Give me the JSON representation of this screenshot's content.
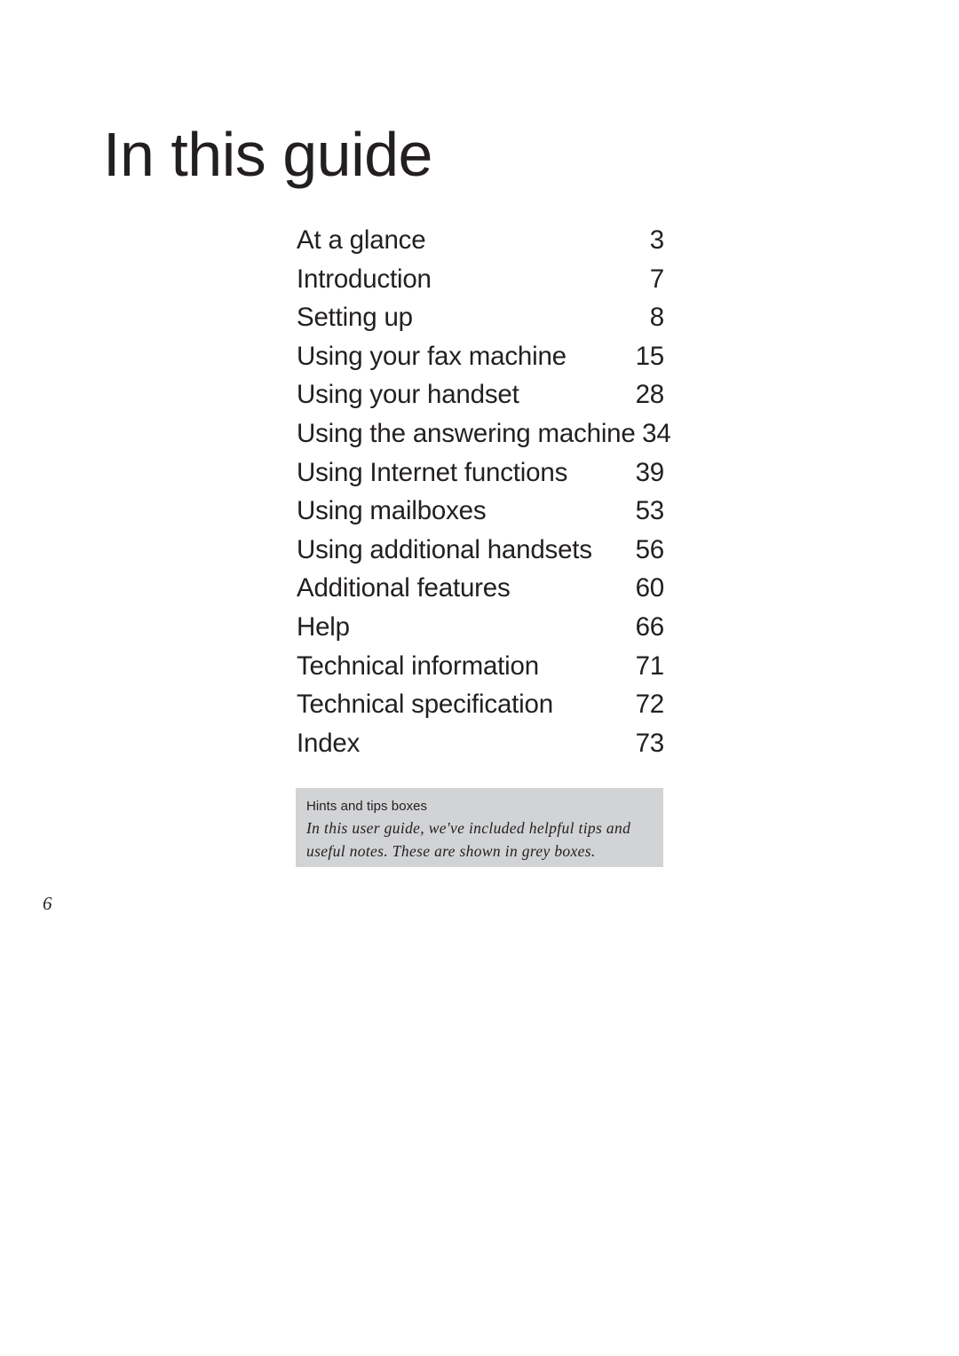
{
  "page": {
    "title": "In this guide",
    "folio": "6",
    "background_color": "#ffffff",
    "text_color": "#231f20"
  },
  "contents": {
    "entries": [
      {
        "label": "At a glance",
        "page": "3"
      },
      {
        "label": "Introduction",
        "page": "7"
      },
      {
        "label": "Setting up",
        "page": "8"
      },
      {
        "label": "Using your fax machine",
        "page": "15"
      },
      {
        "label": "Using your handset",
        "page": "28"
      },
      {
        "label": "Using the answering machine",
        "page": "34"
      },
      {
        "label": "Using Internet functions",
        "page": "39"
      },
      {
        "label": "Using mailboxes",
        "page": "53"
      },
      {
        "label": "Using additional handsets",
        "page": "56"
      },
      {
        "label": "Additional features",
        "page": "60"
      },
      {
        "label": "Help",
        "page": "66"
      },
      {
        "label": "Technical information",
        "page": "71"
      },
      {
        "label": "Technical specification",
        "page": "72"
      },
      {
        "label": "Index",
        "page": "73"
      }
    ]
  },
  "hint_box": {
    "background_color": "#d2d3d5",
    "title": "Hints and tips boxes",
    "body_line_1": "In this user guide, we've included helpful tips and",
    "body_line_2": "useful notes. These are shown in grey boxes."
  }
}
